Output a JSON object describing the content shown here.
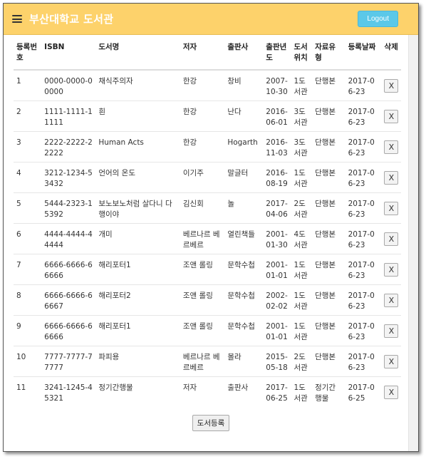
{
  "header": {
    "title": "부산대학교 도서관",
    "logout_label": "Logout",
    "menu_icon": "hamburger-menu-icon",
    "bg_color": "#fdd26b",
    "logout_color": "#5bc8e8"
  },
  "table": {
    "columns": [
      "등록번호",
      "ISBN",
      "도서명",
      "저자",
      "출판사",
      "출판년도",
      "도서위치",
      "자료유형",
      "등록날짜",
      "삭제"
    ],
    "rows": [
      {
        "no": "1",
        "isbn": "0000-0000-00000",
        "title": "채식주의자",
        "author": "한강",
        "publisher": "창비",
        "pub_date": "2007-10-30",
        "location": "1도서관",
        "type": "단행본",
        "reg_date": "2017-06-23",
        "delete": "X"
      },
      {
        "no": "2",
        "isbn": "1111-1111-11111",
        "title": "흰",
        "author": "한강",
        "publisher": "난다",
        "pub_date": "2016-06-01",
        "location": "3도서관",
        "type": "단행본",
        "reg_date": "2017-06-23",
        "delete": "X"
      },
      {
        "no": "3",
        "isbn": "2222-2222-22222",
        "title": "Human Acts",
        "author": "한강",
        "publisher": "Hogarth",
        "pub_date": "2016-11-03",
        "location": "3도서관",
        "type": "단행본",
        "reg_date": "2017-06-23",
        "delete": "X"
      },
      {
        "no": "4",
        "isbn": "3212-1234-53432",
        "title": "언어의 온도",
        "author": "이기주",
        "publisher": "말글터",
        "pub_date": "2016-08-19",
        "location": "1도서관",
        "type": "단행본",
        "reg_date": "2017-06-23",
        "delete": "X"
      },
      {
        "no": "5",
        "isbn": "5444-2323-15392",
        "title": "보노보노처럼 살다니 다행이야",
        "author": "김신회",
        "publisher": "놀",
        "pub_date": "2017-04-06",
        "location": "2도서관",
        "type": "단행본",
        "reg_date": "2017-06-23",
        "delete": "X"
      },
      {
        "no": "6",
        "isbn": "4444-4444-44444",
        "title": "개미",
        "author": "베르나르 베르베르",
        "publisher": "열린책들",
        "pub_date": "2001-01-30",
        "location": "4도서관",
        "type": "단행본",
        "reg_date": "2017-06-23",
        "delete": "X"
      },
      {
        "no": "7",
        "isbn": "6666-6666-66666",
        "title": "해리포터1",
        "author": "조앤 롤링",
        "publisher": "문학수첩",
        "pub_date": "2001-01-01",
        "location": "1도서관",
        "type": "단행본",
        "reg_date": "2017-06-23",
        "delete": "X"
      },
      {
        "no": "8",
        "isbn": "6666-6666-66667",
        "title": "해리포터2",
        "author": "조앤 롤링",
        "publisher": "문학수첩",
        "pub_date": "2002-02-02",
        "location": "1도서관",
        "type": "단행본",
        "reg_date": "2017-06-23",
        "delete": "X"
      },
      {
        "no": "9",
        "isbn": "6666-6666-66666",
        "title": "해리포터1",
        "author": "조앤 롤링",
        "publisher": "문학수첩",
        "pub_date": "2001-01-01",
        "location": "1도서관",
        "type": "단행본",
        "reg_date": "2017-06-23",
        "delete": "X"
      },
      {
        "no": "10",
        "isbn": "7777-7777-77777",
        "title": "파피용",
        "author": "베르나르 베르베르",
        "publisher": "몰라",
        "pub_date": "2015-05-18",
        "location": "2도서관",
        "type": "단행본",
        "reg_date": "2017-06-23",
        "delete": "X"
      },
      {
        "no": "11",
        "isbn": "3241-1245-45321",
        "title": "정기간행물",
        "author": "저자",
        "publisher": "출판사",
        "pub_date": "2017-06-25",
        "location": "1도서관",
        "type": "정기간행물",
        "reg_date": "2017-06-25",
        "delete": "X"
      }
    ]
  },
  "register_label": "도서등록"
}
